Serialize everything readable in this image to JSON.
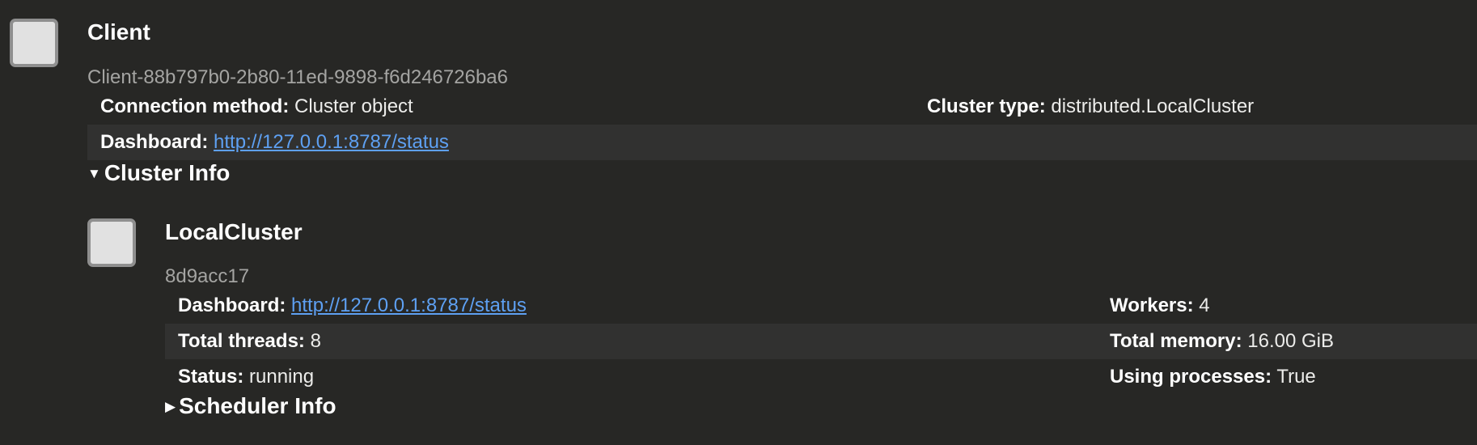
{
  "client": {
    "icon": "square-icon",
    "title": "Client",
    "id": "Client-88b797b0-2b80-11ed-9898-f6d246726ba6",
    "connection_method_label": "Connection method:",
    "connection_method_value": "Cluster object",
    "cluster_type_label": "Cluster type:",
    "cluster_type_value": "distributed.LocalCluster",
    "dashboard_label": "Dashboard:",
    "dashboard_url": "http://127.0.0.1:8787/status",
    "cluster_info_toggle": "Cluster Info",
    "cluster_info_state": "expanded"
  },
  "cluster": {
    "icon": "square-icon",
    "title": "LocalCluster",
    "id": "8d9acc17",
    "dashboard_label": "Dashboard:",
    "dashboard_url": "http://127.0.0.1:8787/status",
    "workers_label": "Workers:",
    "workers_value": "4",
    "threads_label": "Total threads:",
    "threads_value": "8",
    "memory_label": "Total memory:",
    "memory_value": "16.00 GiB",
    "status_label": "Status:",
    "status_value": "running",
    "processes_label": "Using processes:",
    "processes_value": "True",
    "scheduler_info_toggle": "Scheduler Info",
    "scheduler_info_state": "collapsed"
  },
  "colors": {
    "background": "#272725",
    "stripe": "#313130",
    "link": "#5ea0f2",
    "icon_fill": "#e1e1e1",
    "icon_border": "#8f8f8f"
  }
}
